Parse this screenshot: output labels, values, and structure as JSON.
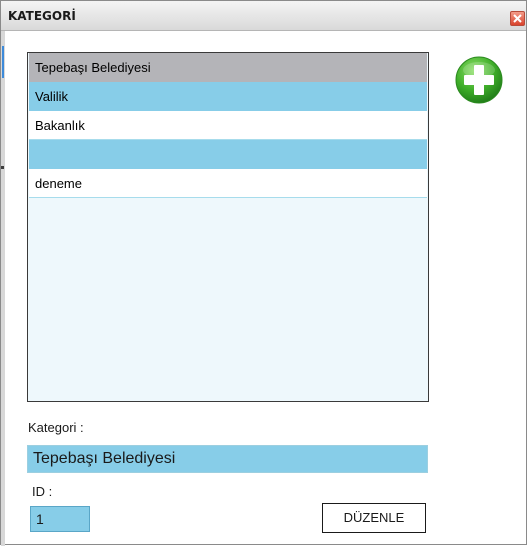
{
  "window": {
    "title": "KATEGORİ"
  },
  "list": {
    "items": [
      {
        "label": "Tepebaşı Belediyesi",
        "state": "selected"
      },
      {
        "label": "Valilik",
        "state": "alternate"
      },
      {
        "label": "Bakanlık",
        "state": "normal"
      },
      {
        "label": "",
        "state": "alternate"
      },
      {
        "label": "deneme",
        "state": "normal"
      }
    ]
  },
  "add_button": {
    "icon": "plus-circle-icon"
  },
  "form": {
    "kategori_label": "Kategori :",
    "kategori_value": "Tepebaşı Belediyesi",
    "id_label": "ID :",
    "id_value": "1",
    "edit_button_label": "DÜZENLE"
  },
  "colors": {
    "selected_row": "#b4b4b8",
    "alternate_row": "#87cde8",
    "list_background": "#eef8fc",
    "add_icon_green": "#3fae29"
  }
}
